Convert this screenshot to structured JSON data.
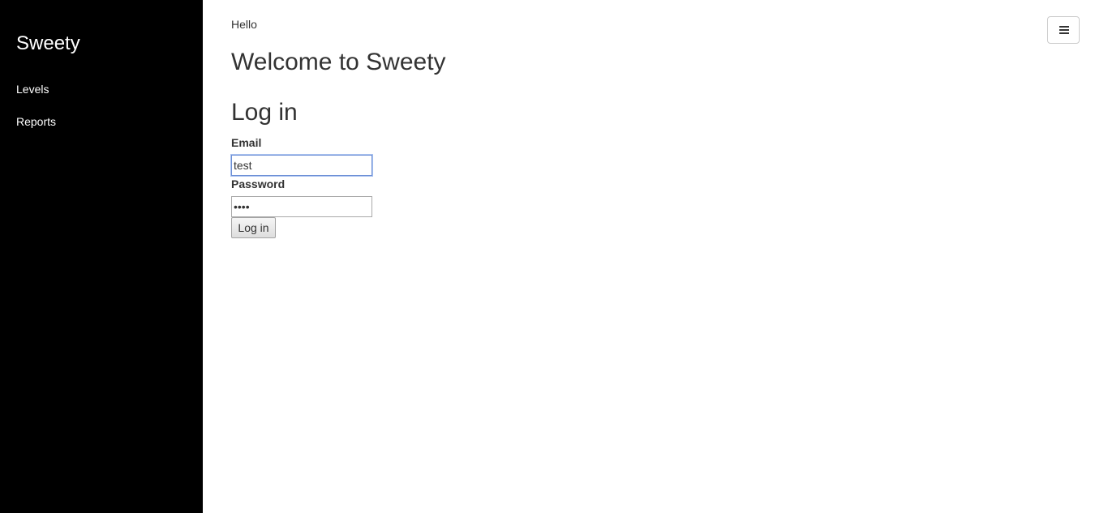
{
  "sidebar": {
    "brand": "Sweety",
    "items": [
      {
        "label": "Levels"
      },
      {
        "label": "Reports"
      }
    ]
  },
  "main": {
    "greeting": "Hello",
    "welcome_heading": "Welcome to Sweety",
    "login": {
      "heading": "Log in",
      "email_label": "Email",
      "email_value": "test",
      "password_label": "Password",
      "password_value": "test",
      "submit_label": "Log in"
    },
    "menu_toggle_icon": "hamburger-icon"
  }
}
